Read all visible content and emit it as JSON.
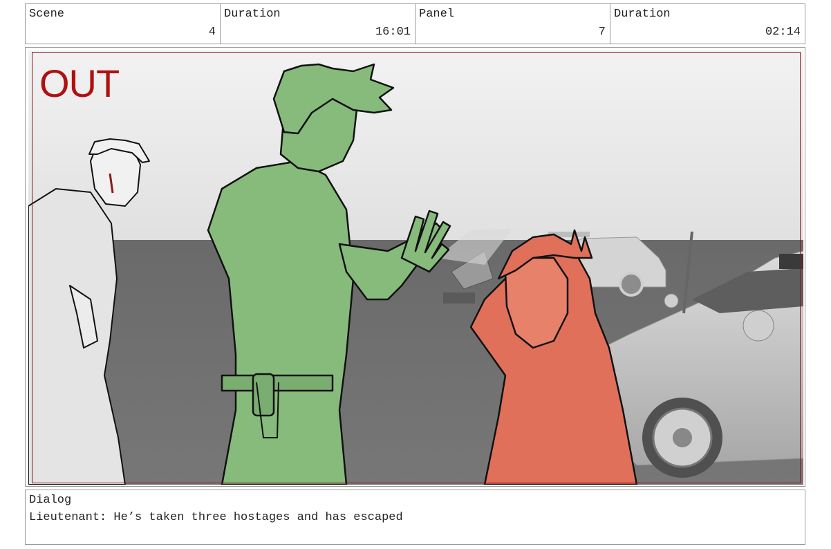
{
  "header": {
    "cells": [
      {
        "label": "Scene",
        "value": "4"
      },
      {
        "label": "Duration",
        "value": "16:01"
      },
      {
        "label": "Panel",
        "value": "7"
      },
      {
        "label": "Duration",
        "value": "02:14"
      }
    ]
  },
  "panel": {
    "transition": "OUT",
    "colors": {
      "transition_text": "#b01010",
      "safe_frame": "#8b1a1a",
      "lieutenant_fill": "#86bb7c",
      "hooded_figure_fill": "#e0705a",
      "sky": "#eeeeee",
      "ground": "#6f6f6f"
    }
  },
  "dialog": {
    "label": "Dialog",
    "text": "Lieutenant: He’s taken three hostages and has escaped"
  }
}
